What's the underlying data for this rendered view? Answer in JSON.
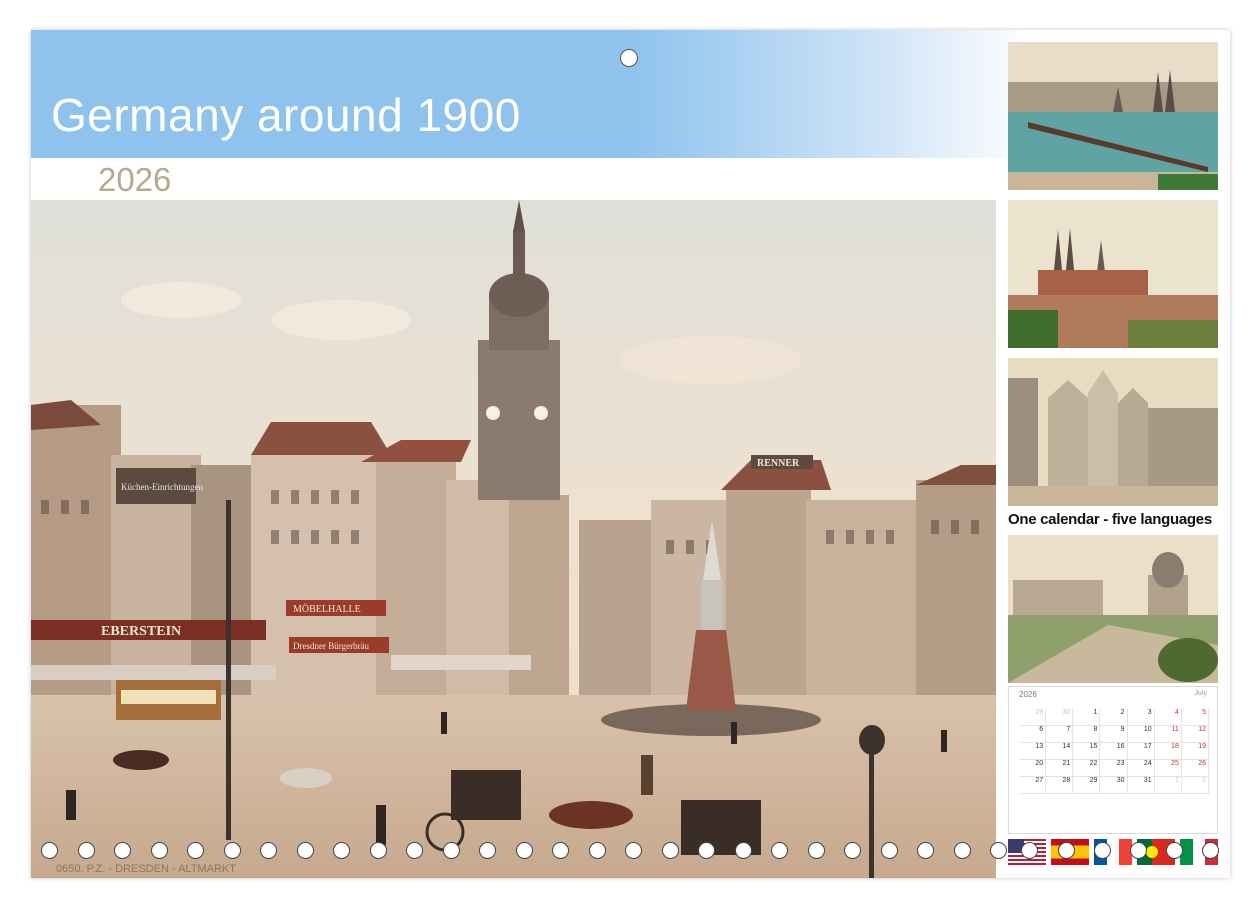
{
  "header": {
    "title": "Germany around 1900",
    "year": "2026"
  },
  "main_photo": {
    "caption": "0650. P.Z. - DRESDEN - ALTMARKT",
    "signs": [
      "Küchen-Einrichtungen",
      "EBERSTEIN",
      "MÖBELHALLE",
      "Dresdner Bürgerbräu",
      "RENNER"
    ]
  },
  "sidebar": {
    "tagline": "One calendar - five languages"
  },
  "calendar_preview": {
    "year": "2026",
    "month": "July",
    "days": [
      [
        "29",
        "30",
        "1",
        "2",
        "3",
        "4",
        "5"
      ],
      [
        "6",
        "7",
        "8",
        "9",
        "10",
        "11",
        "12"
      ],
      [
        "13",
        "14",
        "15",
        "16",
        "17",
        "18",
        "19"
      ],
      [
        "20",
        "21",
        "22",
        "23",
        "24",
        "25",
        "26"
      ],
      [
        "27",
        "28",
        "29",
        "30",
        "31",
        "1",
        "2"
      ]
    ],
    "weekday_header": [
      "",
      "",
      "",
      "",
      "",
      "",
      ""
    ]
  },
  "flags": [
    "usa-flag",
    "spain-flag",
    "france-flag",
    "portugal-flag",
    "italy-flag"
  ],
  "colors": {
    "banner": "#8fc3ee",
    "year_text": "#b7a98f",
    "sepia_sky": "#efe1cf"
  }
}
